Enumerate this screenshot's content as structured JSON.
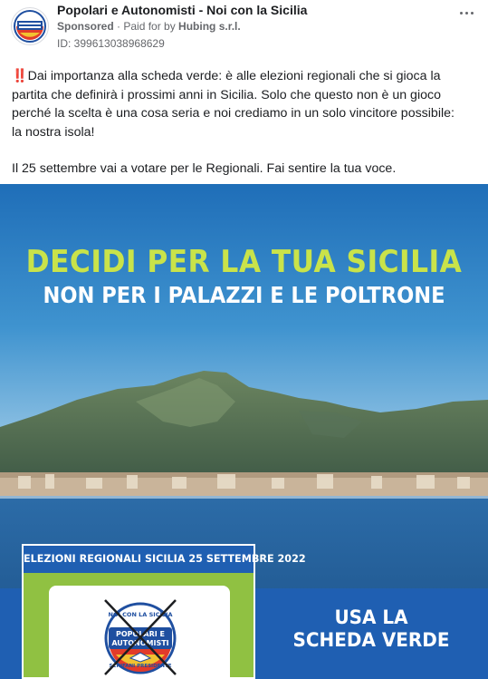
{
  "post": {
    "page_name": "Popolari e Autonomisti - Noi con la Sicilia",
    "sponsored_label": "Sponsored",
    "separator": " · ",
    "paid_for_prefix": "Paid for by ",
    "payer": "Hubing s.r.l.",
    "ad_id": "ID: 399613038968629",
    "more_icon": "ellipsis-icon"
  },
  "body": {
    "paragraph_1": "‼️Dai importanza alla scheda verde: è alle elezioni regionali che si gioca la partita che definirà i prossimi anni in Sicilia. Solo che questo non è un gioco perché la scelta è una cosa seria e noi crediamo in un solo vincitore possibile: la nostra isola!",
    "paragraph_2": "Il 25 settembre vai a votare per le Regionali. Fai sentire la tua voce."
  },
  "creative": {
    "headline_1": "DECIDI PER LA TUA SICILIA",
    "headline_2": "NON PER I PALAZZI E LE POLTRONE",
    "ballot_header": "ELEZIONI REGIONALI SICILIA 25 SETTEMBRE 2022",
    "cta_line_1": "USA LA",
    "cta_line_2": "SCHEDA VERDE",
    "logo_top_text": "NOI CON LA SICILIA",
    "logo_main_1": "POPOLARI E",
    "logo_main_2": "AUTONOMISTI",
    "logo_bottom_text": "SCHIFANI PRESIDENTE"
  },
  "colors": {
    "headline_accent": "#c9e34a",
    "brand_blue": "#1f5fb2",
    "ballot_green": "#90c142"
  }
}
